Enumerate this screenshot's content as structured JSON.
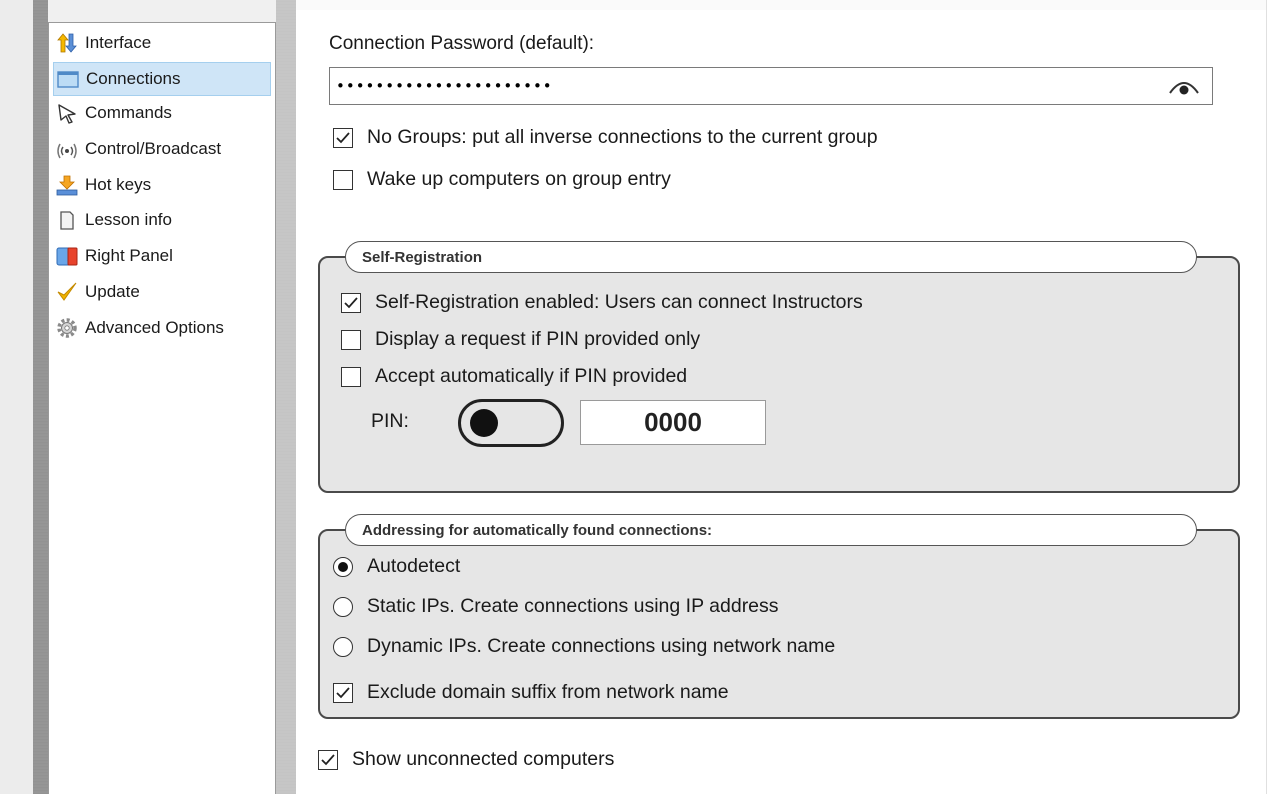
{
  "sidebar": {
    "items": [
      {
        "label": "Interface",
        "icon": "interface-arrows-icon"
      },
      {
        "label": "Connections",
        "icon": "connections-window-icon"
      },
      {
        "label": "Commands",
        "icon": "cursor-arrow-icon"
      },
      {
        "label": "Control/Broadcast",
        "icon": "broadcast-icon"
      },
      {
        "label": "Hot keys",
        "icon": "hotkey-icon"
      },
      {
        "label": "Lesson info",
        "icon": "document-icon"
      },
      {
        "label": "Right Panel",
        "icon": "right-panel-icon"
      },
      {
        "label": "Update",
        "icon": "checkmark-icon"
      },
      {
        "label": "Advanced Options",
        "icon": "gear-icon"
      }
    ],
    "selected": "Connections"
  },
  "connection": {
    "password_label": "Connection Password (default):",
    "password_value": "••••••••••••••••••••••",
    "no_groups_label": "No Groups: put all inverse connections to the current group",
    "no_groups_checked": true,
    "wake_up_label": "Wake up computers on group entry",
    "wake_up_checked": false
  },
  "self_registration": {
    "title": "Self-Registration",
    "enabled_label": "Self-Registration enabled: Users can connect Instructors",
    "enabled_checked": true,
    "display_request_label": "Display a request if PIN provided only",
    "display_request_checked": false,
    "accept_auto_label": "Accept automatically if PIN provided",
    "accept_auto_checked": false,
    "pin_label": "PIN:",
    "pin_toggle_on": false,
    "pin_value": "0000"
  },
  "addressing": {
    "title": "Addressing for automatically found connections:",
    "options": [
      {
        "label": "Autodetect",
        "selected": true
      },
      {
        "label": "Static IPs. Create connections using IP address",
        "selected": false
      },
      {
        "label": "Dynamic IPs. Create connections using network name",
        "selected": false
      }
    ],
    "exclude_suffix_label": "Exclude domain suffix from network name",
    "exclude_suffix_checked": true
  },
  "show_unconnected_label": "Show unconnected computers",
  "show_unconnected_checked": true
}
